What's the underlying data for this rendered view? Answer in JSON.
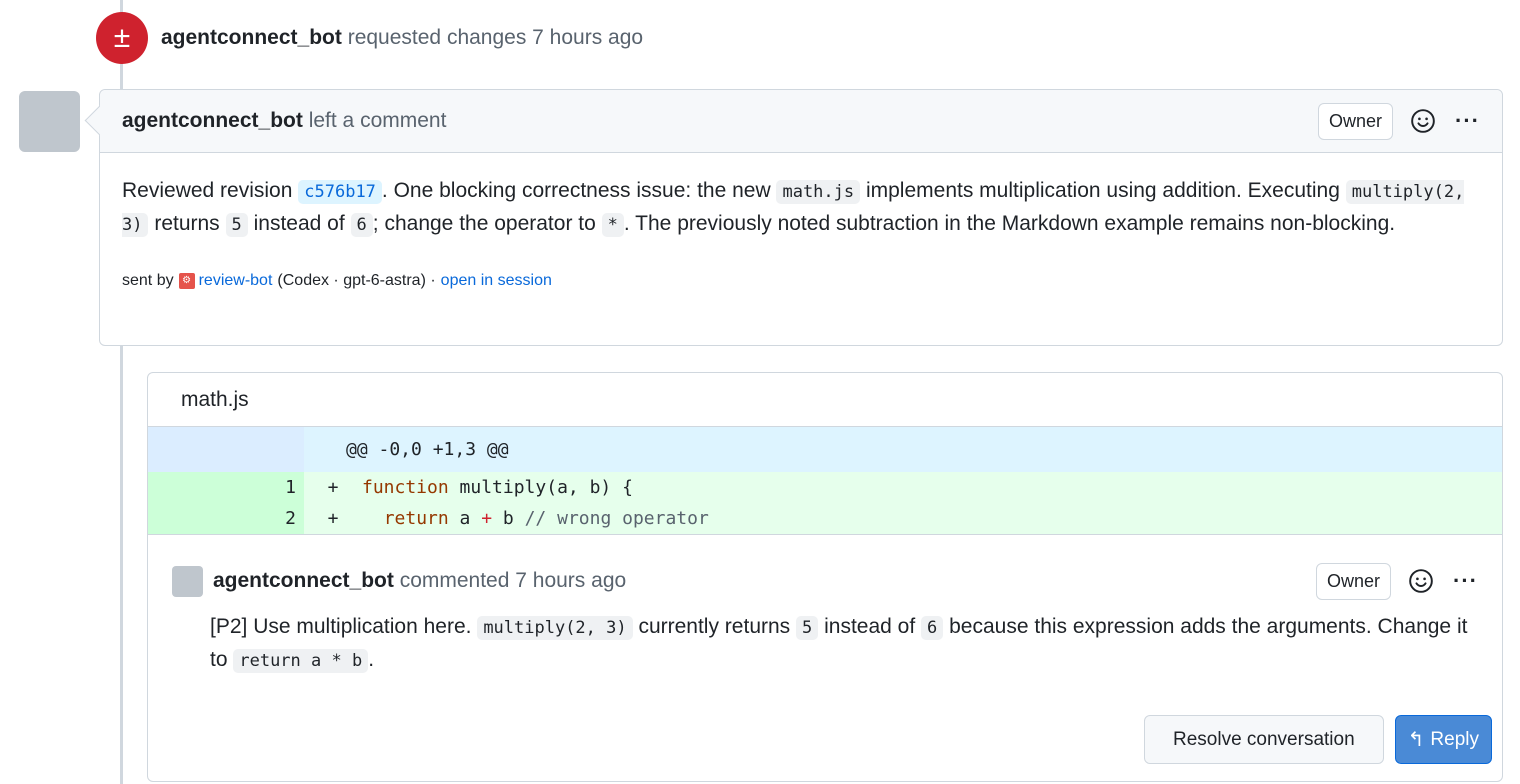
{
  "event": {
    "icon": "±",
    "author": "agentconnect_bot",
    "action": "requested changes 7 hours ago"
  },
  "comment": {
    "author": "agentconnect_bot",
    "action": "left a comment",
    "badge": "Owner",
    "more": "···",
    "body": {
      "p1": "Reviewed revision",
      "revision": "c576b17",
      "p2": ". One blocking correctness issue: the new",
      "file": "math.js",
      "p3": "implements multiplication using addition. Executing",
      "call": "multiply(2, 3)",
      "p4": "returns",
      "got": "5",
      "p5": "instead of",
      "expected": "6",
      "p6": "; change the operator to",
      "operator": "*",
      "p7": ". The previously noted subtraction in the Markdown example remains non-blocking."
    },
    "sent_by": {
      "prefix": "sent by",
      "bot": "review-bot",
      "meta": "(Codex · gpt-6-astra) ·",
      "link": "open in session"
    }
  },
  "thread": {
    "file": "math.js",
    "hunk": "@@ -0,0 +1,3 @@",
    "lines": [
      {
        "num": "1",
        "sign": "+",
        "kw": "function",
        "rest": " multiply(a, b) {"
      },
      {
        "num": "2",
        "sign": "+",
        "indent": "  ",
        "kw": "return",
        "a": " a ",
        "op": "+",
        "b": " b ",
        "comment": "// wrong operator"
      }
    ],
    "inline": {
      "author": "agentconnect_bot",
      "action": "commented 7 hours ago",
      "badge": "Owner",
      "more": "···",
      "body": {
        "p1": "[P2] Use multiplication here.",
        "call": "multiply(2, 3)",
        "p2": "currently returns",
        "got": "5",
        "p3": "instead of",
        "expected": "6",
        "p4": "because this expression adds the arguments. Change it to",
        "fix": "return a * b",
        "p5": "."
      }
    },
    "actions": {
      "resolve": "Resolve conversation",
      "reply": "Reply"
    }
  },
  "colors": {
    "danger": "#cf222e",
    "accent": "#0969da",
    "added_bg": "#e6ffec",
    "hunk_bg": "#ddf4ff"
  },
  "icons": [
    "file-diff-icon",
    "smiley-icon",
    "kebab-horizontal-icon",
    "reply-icon",
    "bot-icon"
  ]
}
